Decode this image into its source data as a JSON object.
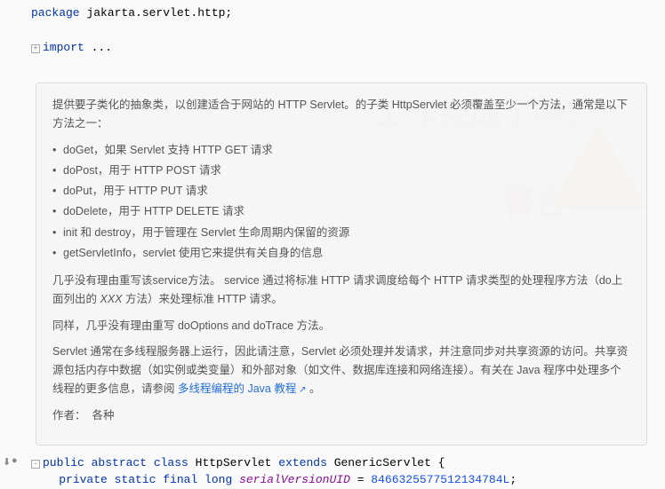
{
  "code": {
    "package_kw": "package",
    "package_name": " jakarta.servlet.http;",
    "import_kw": "import",
    "import_rest": " ...",
    "class_decl": {
      "public": "public",
      "abstract": " abstract",
      "class_kw": " class",
      "name": " HttpServlet",
      "extends_kw": " extends",
      "super": " GenericServlet",
      "brace": " {"
    },
    "field_decl": {
      "private": "private",
      "static": " static",
      "final": " final",
      "long": " long",
      "name": " serialVersionUID",
      "eq": " = ",
      "value": "8466325577512134784L",
      "semi": ";"
    }
  },
  "doc": {
    "intro": "提供要子类化的抽象类，以创建适合于网站的 HTTP Servlet。的子类 HttpServlet 必须覆盖至少一个方法，通常是以下方法之一：",
    "items": [
      "doGet，如果 Servlet 支持 HTTP GET 请求",
      "doPost，用于 HTTP POST 请求",
      "doPut，用于 HTTP PUT 请求",
      "doDelete，用于 HTTP DELETE 请求",
      "init 和 destroy，用于管理在 Servlet 生命周期内保留的资源",
      "getServletInfo，servlet 使用它来提供有关自身的信息"
    ],
    "p2a": "几乎没有理由重写该service方法。 service 通过将标准 HTTP 请求调度给每个 HTTP 请求类型的处理程序方法（do上面列出的 ",
    "p2b": "XXX",
    "p2c": " 方法）来处理标准 HTTP 请求。",
    "p3": "同样，几乎没有理由重写 doOptions and doTrace 方法。",
    "p4a": "Servlet 通常在多线程服务器上运行，因此请注意，Servlet 必须处理并发请求，并注意同步对共享资源的访问。共享资源包括内存中数据（如实例或类变量）和外部对象（如文件、数据库连接和网络连接）。有关在 Java 程序中处理多个线程的更多信息，请参阅 ",
    "p4link": "多线程编程的 Java 教程",
    "p4b": " 。",
    "author_label": "作者：",
    "author_value": "各种"
  },
  "watermark": {
    "line1": "工作完成了咩？！",
    "line2": "警告"
  },
  "chart_data": null
}
